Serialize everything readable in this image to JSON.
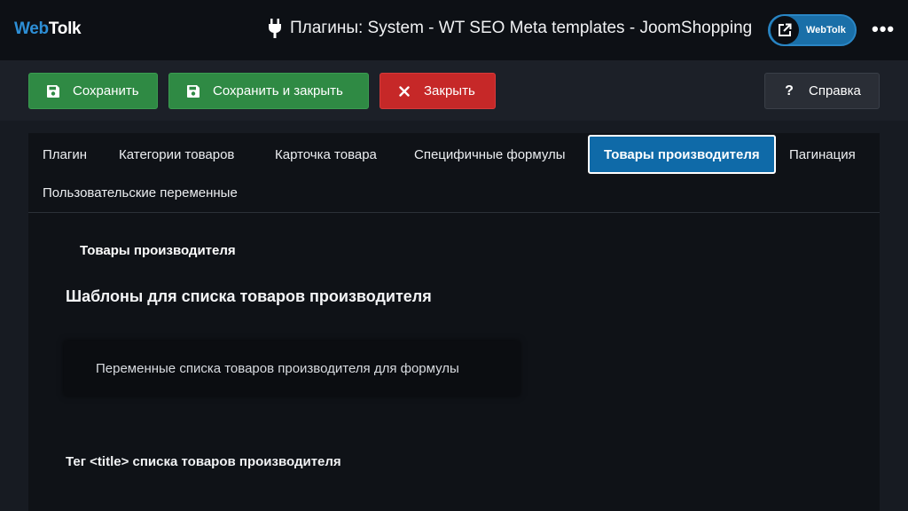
{
  "header": {
    "logo_part1": "Web",
    "logo_part2": "Tolk",
    "title": "Плагины: System - WT SEO Meta templates - JoomShopping",
    "site_button_label": "WebTolk",
    "more_label": "•••"
  },
  "toolbar": {
    "save_label": "Сохранить",
    "save_close_label": "Сохранить и закрыть",
    "close_label": "Закрыть",
    "help_label": "Справка"
  },
  "tabs": [
    {
      "label": "Плагин"
    },
    {
      "label": "Категории товаров"
    },
    {
      "label": "Карточка товара"
    },
    {
      "label": "Специфичные формулы"
    },
    {
      "label": "Товары производителя",
      "active": true
    },
    {
      "label": "Пагинация"
    },
    {
      "label": "Пользовательские переменные"
    }
  ],
  "content": {
    "section_label": "Товары производителя",
    "group_title": "Шаблоны для списка товаров производителя",
    "variables_toggle": "Переменные списка товаров производителя для формулы",
    "title_tag_label": "Тег <title> списка товаров производителя"
  },
  "colors": {
    "success": "#2f8a44",
    "danger": "#c62828",
    "primary": "#0f6aa8",
    "brand": "#2d8fd6"
  },
  "icons": {
    "title": "plug-icon",
    "site": "external-link-icon",
    "save": "floppy-disk-icon",
    "close": "x-icon",
    "help": "question-icon"
  }
}
